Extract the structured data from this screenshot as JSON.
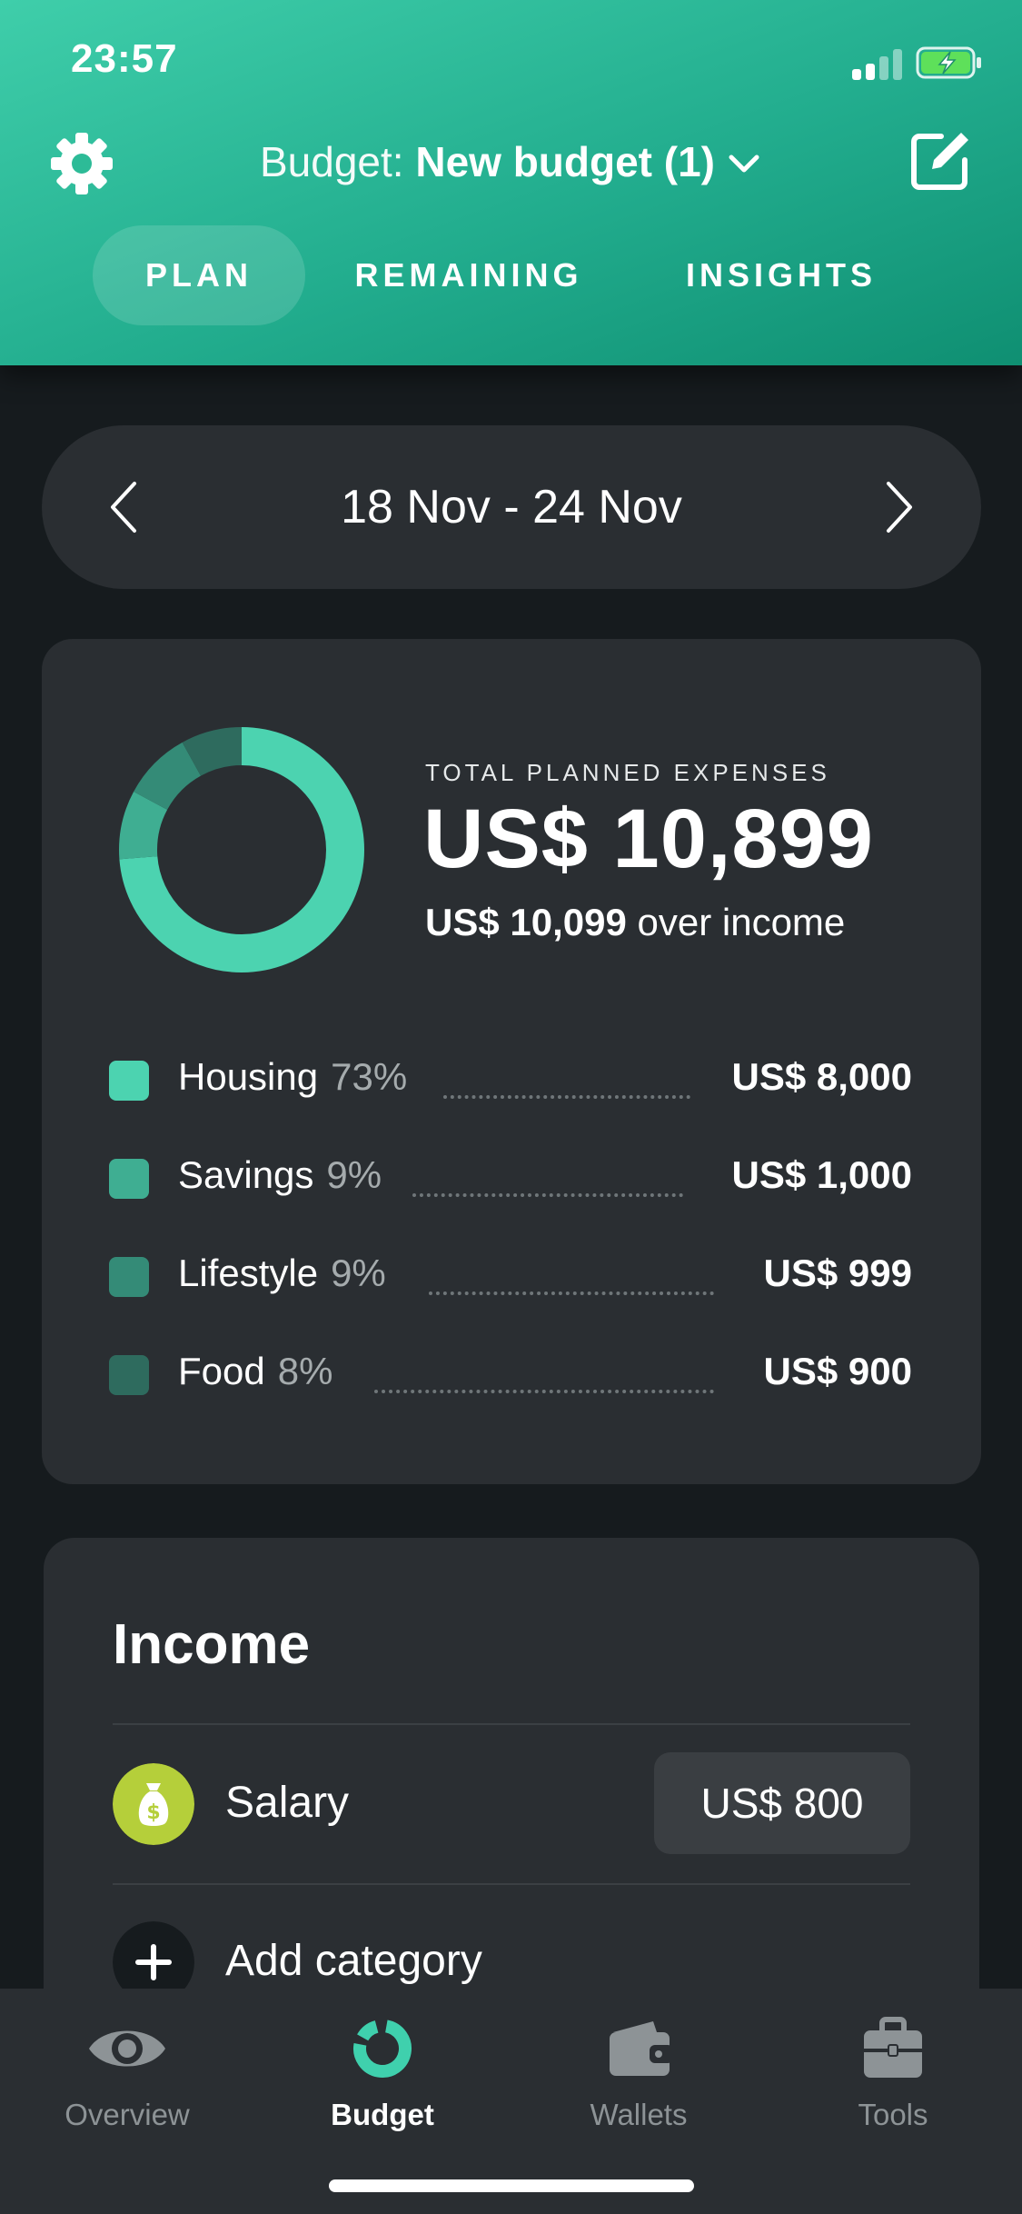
{
  "status_bar": {
    "time": "23:57"
  },
  "header": {
    "title_prefix": "Budget: ",
    "budget_name": "New budget (1)",
    "tabs": [
      {
        "label": "PLAN",
        "active": true
      },
      {
        "label": "REMAINING",
        "active": false
      },
      {
        "label": "INSIGHTS",
        "active": false
      }
    ]
  },
  "date_range": {
    "label": "18 Nov - 24 Nov"
  },
  "summary": {
    "total_label": "TOTAL PLANNED EXPENSES",
    "total_value": "US$ 10,899",
    "over_amount": "US$ 10,099",
    "over_text": " over income",
    "categories": [
      {
        "name": "Housing",
        "percent": "73%",
        "amount": "US$ 8,000",
        "color": "#4cd3b0",
        "share": 73
      },
      {
        "name": "Savings",
        "percent": "9%",
        "amount": "US$ 1,000",
        "color": "#3fae92",
        "share": 9
      },
      {
        "name": "Lifestyle",
        "percent": "9%",
        "amount": "US$ 999",
        "color": "#348b77",
        "share": 9
      },
      {
        "name": "Food",
        "percent": "8%",
        "amount": "US$ 900",
        "color": "#2e6b5e",
        "share": 8
      }
    ]
  },
  "income": {
    "title": "Income",
    "items": [
      {
        "label": "Salary",
        "amount": "US$ 800",
        "icon": "money-bag-icon",
        "icon_color": "#b5cf3a"
      }
    ],
    "add_label": "Add category"
  },
  "bottom_nav": [
    {
      "label": "Overview",
      "icon": "eye-icon",
      "active": false
    },
    {
      "label": "Budget",
      "icon": "budget-donut-icon",
      "active": true
    },
    {
      "label": "Wallets",
      "icon": "wallet-icon",
      "active": false
    },
    {
      "label": "Tools",
      "icon": "briefcase-icon",
      "active": false
    }
  ],
  "colors": {
    "accent": "#2ec4a0",
    "background": "#161b1e",
    "card": "#2a2e32"
  }
}
